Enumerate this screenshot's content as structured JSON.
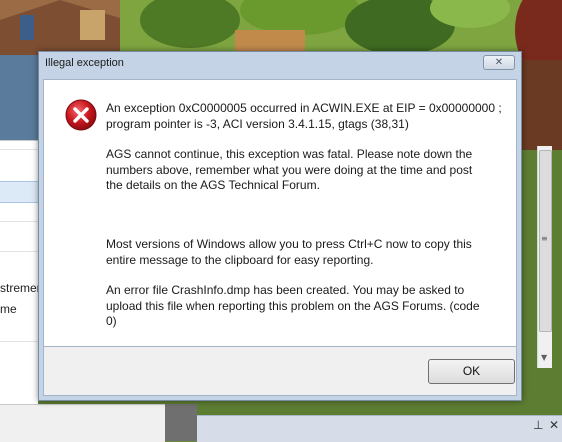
{
  "dialog": {
    "title": "Illegal exception",
    "close_glyph": "✕",
    "icon": "error-icon",
    "messages": [
      "An exception 0xC0000005 occurred in ACWIN.EXE at EIP = 0x00000000 ;\nprogram pointer is -3, ACI version 3.4.1.15, gtags (38,31)",
      "AGS cannot continue, this exception was fatal. Please note down the\nnumbers above, remember what you were doing at the time and post\nthe details on the AGS Technical Forum.",
      "Most versions of Windows allow you to press Ctrl+C now to copy this\nentire message to the clipboard for easy reporting.",
      "An error file CrashInfo.dmp has been created. You may be asked to\nupload this file when reporting this problem on the AGS Forums. (code\n0)"
    ],
    "ok_label": "OK"
  },
  "background_window": {
    "partial_texts": [
      "stremer",
      "me"
    ]
  },
  "taskbar": {
    "pin_glyph": "⊥",
    "close_glyph": "✕"
  },
  "colors": {
    "dialog_frame": "#c5d3e6",
    "error_red": "#c8161d"
  }
}
